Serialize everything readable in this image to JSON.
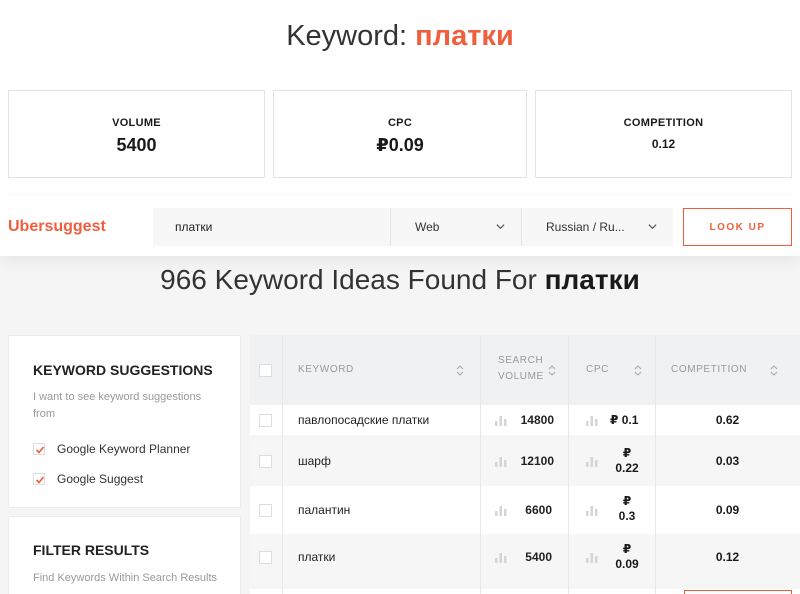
{
  "header": {
    "prefix": "Keyword: ",
    "keyword": "платки"
  },
  "stats": [
    {
      "label": "VOLUME",
      "value": "5400"
    },
    {
      "label": "CPC",
      "value": "₽0.09"
    },
    {
      "label": "COMPETITION",
      "value": "0.12"
    }
  ],
  "search_bar": {
    "logo": "Ubersuggest",
    "query": "платки",
    "source": "Web",
    "language": "Russian / Ru...",
    "button": "LOOK UP"
  },
  "results_heading": {
    "prefix": "966 Keyword Ideas Found For ",
    "keyword": "платки"
  },
  "suggestions_panel": {
    "title": "KEYWORD SUGGESTIONS",
    "desc": "I want to see keyword suggestions from",
    "options": [
      {
        "label": "Google Keyword Planner",
        "checked": true
      },
      {
        "label": "Google Suggest",
        "checked": true
      }
    ]
  },
  "filter_panel": {
    "title": "FILTER RESULTS",
    "desc": "Find Keywords Within Search Results"
  },
  "table": {
    "columns": {
      "keyword": "KEYWORD",
      "volume_line1": "SEARCH",
      "volume_line2": "VOLUME",
      "cpc": "CPC",
      "competition": "COMPETITION"
    },
    "rows": [
      {
        "keyword": "павлопосадские платки",
        "volume": "14800",
        "cpc_symbol": "₽",
        "cpc_value": "0.1",
        "competition": "0.62"
      },
      {
        "keyword": "шарф",
        "volume": "12100",
        "cpc_symbol": "₽",
        "cpc_value": "0.22",
        "competition": "0.03"
      },
      {
        "keyword": "палантин",
        "volume": "6600",
        "cpc_symbol": "₽",
        "cpc_value": "0.3",
        "competition": "0.09"
      },
      {
        "keyword": "платки",
        "volume": "5400",
        "cpc_symbol": "₽",
        "cpc_value": "0.09",
        "competition": "0.12"
      }
    ]
  },
  "colors": {
    "accent": "#f05f3d",
    "muted": "#999999"
  }
}
